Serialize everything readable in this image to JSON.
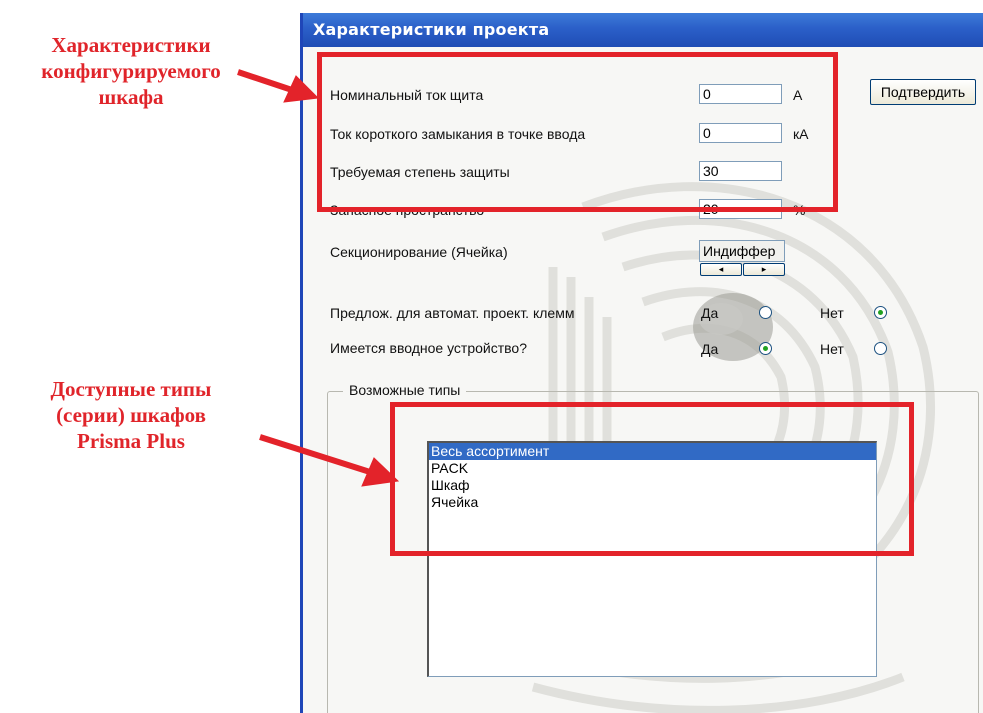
{
  "annotations": {
    "config_caption": [
      "Характеристики",
      "конфигурируемого",
      "шкафа"
    ],
    "types_caption": [
      "Доступные типы",
      "(серии) шкафов",
      "Prisma Plus"
    ],
    "highlight_color": "#e3232a"
  },
  "window": {
    "title": "Характеристики проекта",
    "confirm_button": "Подтвердить"
  },
  "fields": {
    "nominal_current": {
      "label": "Номинальный ток щита",
      "value": "0",
      "unit": "A"
    },
    "short_circuit": {
      "label": "Ток короткого замыкания в точке ввода",
      "value": "0",
      "unit": "кА"
    },
    "protection": {
      "label": "Требуемая степень защиты",
      "value": "30"
    },
    "spare_space": {
      "label": "Запасное пространство",
      "value": "20",
      "unit": "%"
    },
    "sectioning": {
      "label": "Секционирование (Ячейка)",
      "value": "Индиффер"
    }
  },
  "radios": {
    "terminals": {
      "label": "Предлож. для автомат. проект. клемм",
      "yes": "Да",
      "no": "Нет",
      "selected": "no"
    },
    "input_device": {
      "label": "Имеется вводное устройство?",
      "yes": "Да",
      "no": "Нет",
      "selected": "yes"
    }
  },
  "types_group": {
    "legend": "Возможные типы",
    "items": [
      "Весь ассортимент",
      "PACK",
      "Шкаф",
      "Ячейка"
    ],
    "selected_index": 0
  }
}
